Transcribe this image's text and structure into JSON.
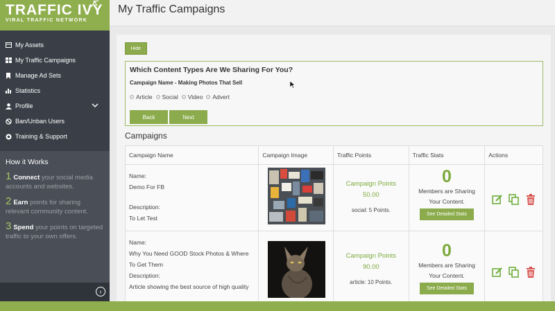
{
  "brand": {
    "name": "TRAFFIC IVY",
    "tagline": "VIRAL TRAFFIC NETWORK",
    "color": "#8fae4e"
  },
  "sidebar": {
    "items": [
      {
        "label": "My Assets",
        "icon": "wallet-icon"
      },
      {
        "label": "My Traffic Campaigns",
        "icon": "grid-icon"
      },
      {
        "label": "Manage Ad Sets",
        "icon": "bookmark-icon"
      },
      {
        "label": "Statistics",
        "icon": "bar-chart-icon"
      },
      {
        "label": "Profile",
        "icon": "user-icon"
      },
      {
        "label": "Ban/Unban Users",
        "icon": "ban-icon"
      },
      {
        "label": "Training & Support",
        "icon": "support-icon"
      }
    ]
  },
  "how_it_works": {
    "title": "How it Works",
    "steps": [
      {
        "num": "1",
        "strong": "Connect",
        "rest": " your social media accounts and websites."
      },
      {
        "num": "2",
        "strong": "Earn",
        "rest": " points for sharing relevant community content."
      },
      {
        "num": "3",
        "strong": "Spend",
        "rest": " your points on targeted traffic to your own offers."
      }
    ]
  },
  "header": {
    "title": "My Traffic Campaigns"
  },
  "share_box": {
    "hide_label": "Hide",
    "title": "Which Content Types Are We Sharing For You?",
    "campaign_name": "Campaign Name - Making Photos That Sell",
    "types": [
      "Article",
      "Social",
      "Video",
      "Advert"
    ],
    "back_label": "Back",
    "next_label": "Next"
  },
  "campaigns": {
    "heading": "Campaigns",
    "columns": [
      "Campaign Name",
      "Campaign Image",
      "Traffic Points",
      "Traffic Stats",
      "Actions"
    ],
    "name_label": "Name:",
    "description_label": "Description:",
    "points_label": "Campaign Points",
    "members_text_1": "Members are Sharing",
    "members_text_2": "Your Content.",
    "stats_button": "See Detailed Stats",
    "rows": [
      {
        "name": "Demo For FB",
        "description": "To Let Test",
        "points": "50.00",
        "points_note": "social: 5 Points.",
        "sharing": "0"
      },
      {
        "name": "Why You Need GOOD Stock Photos & Where To Get Them",
        "description": "Article showing the best source of high quality",
        "points": "90.00",
        "points_note": "article: 10 Points.",
        "sharing": "0"
      }
    ]
  },
  "colors": {
    "accent": "#8bab4c",
    "sidebar": "#3a3f47",
    "delete": "#d9534f"
  }
}
